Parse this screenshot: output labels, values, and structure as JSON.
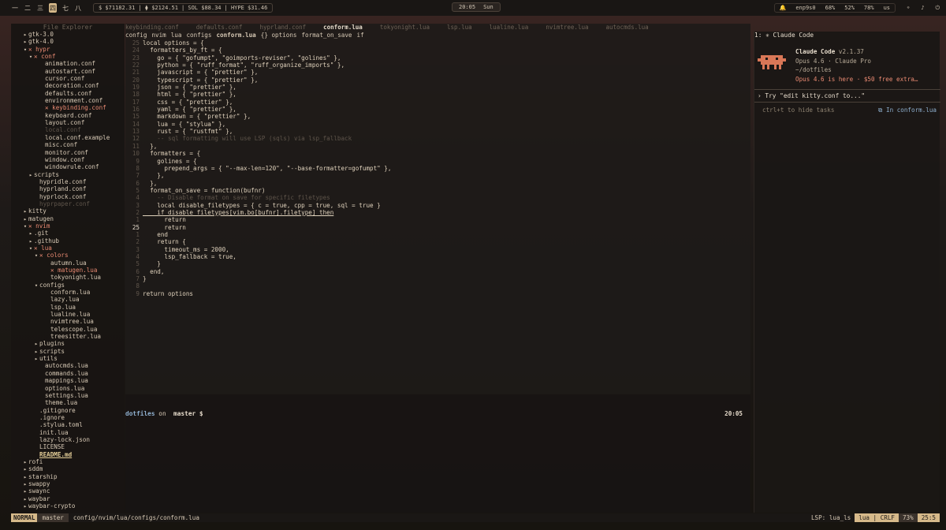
{
  "topbar": {
    "workspaces": [
      "一",
      "二",
      "三",
      "四",
      "七",
      "八"
    ],
    "active_index": 3,
    "crypto": [
      "$ $71182.31",
      "| ⧫ $2124.51",
      "| SOL $88.34",
      "| HYPE $31.46"
    ],
    "clock_time": "20:05",
    "clock_day": "Sun",
    "tray": {
      "network": "enp9s0",
      "cpu": "68%",
      "gpu": "52%",
      "mem": "78%",
      "kb": "us"
    }
  },
  "file_tree": {
    "header": "File Explorer",
    "rows": [
      {
        "indent": 2,
        "icon": "▸",
        "label": "gtk-3.0",
        "cls": ""
      },
      {
        "indent": 2,
        "icon": "▸",
        "label": "gtk-4.0",
        "cls": ""
      },
      {
        "indent": 2,
        "icon": "▾",
        "label": "✕ hypr",
        "cls": "mod"
      },
      {
        "indent": 3,
        "icon": "▾",
        "label": "✕ conf",
        "cls": "mod"
      },
      {
        "indent": 5,
        "icon": "",
        "label": "animation.conf",
        "cls": ""
      },
      {
        "indent": 5,
        "icon": "",
        "label": "autostart.conf",
        "cls": ""
      },
      {
        "indent": 5,
        "icon": "",
        "label": "cursor.conf",
        "cls": ""
      },
      {
        "indent": 5,
        "icon": "",
        "label": "decoration.conf",
        "cls": ""
      },
      {
        "indent": 5,
        "icon": "",
        "label": "defaults.conf",
        "cls": ""
      },
      {
        "indent": 5,
        "icon": "",
        "label": "environment.conf",
        "cls": ""
      },
      {
        "indent": 5,
        "icon": "",
        "label": "✕ keybinding.conf",
        "cls": "mod"
      },
      {
        "indent": 5,
        "icon": "",
        "label": "keyboard.conf",
        "cls": ""
      },
      {
        "indent": 5,
        "icon": "",
        "label": "layout.conf",
        "cls": ""
      },
      {
        "indent": 5,
        "icon": "",
        "label": "local.conf",
        "cls": "dim"
      },
      {
        "indent": 5,
        "icon": "",
        "label": "local.conf.example",
        "cls": ""
      },
      {
        "indent": 5,
        "icon": "",
        "label": "misc.conf",
        "cls": ""
      },
      {
        "indent": 5,
        "icon": "",
        "label": "monitor.conf",
        "cls": ""
      },
      {
        "indent": 5,
        "icon": "",
        "label": "window.conf",
        "cls": ""
      },
      {
        "indent": 5,
        "icon": "",
        "label": "windowrule.conf",
        "cls": ""
      },
      {
        "indent": 3,
        "icon": "▸",
        "label": "scripts",
        "cls": ""
      },
      {
        "indent": 4,
        "icon": "",
        "label": "hypridle.conf",
        "cls": ""
      },
      {
        "indent": 4,
        "icon": "",
        "label": "hyprland.conf",
        "cls": ""
      },
      {
        "indent": 4,
        "icon": "",
        "label": "hyprlock.conf",
        "cls": ""
      },
      {
        "indent": 4,
        "icon": "",
        "label": "hyprpaper.conf",
        "cls": "dim"
      },
      {
        "indent": 2,
        "icon": "▸",
        "label": "kitty",
        "cls": ""
      },
      {
        "indent": 2,
        "icon": "▸",
        "label": "matugen",
        "cls": ""
      },
      {
        "indent": 2,
        "icon": "▾",
        "label": "✕ nvim",
        "cls": "mod"
      },
      {
        "indent": 3,
        "icon": "▸",
        "label": ".git",
        "cls": ""
      },
      {
        "indent": 3,
        "icon": "▸",
        "label": ".github",
        "cls": ""
      },
      {
        "indent": 3,
        "icon": "▾",
        "label": "✕ lua",
        "cls": "mod"
      },
      {
        "indent": 4,
        "icon": "▾",
        "label": "✕ colors",
        "cls": "mod"
      },
      {
        "indent": 6,
        "icon": "",
        "label": "autumn.lua",
        "cls": ""
      },
      {
        "indent": 6,
        "icon": "",
        "label": "✕ matugen.lua",
        "cls": "mod"
      },
      {
        "indent": 6,
        "icon": "",
        "label": "tokyonight.lua",
        "cls": ""
      },
      {
        "indent": 4,
        "icon": "▾",
        "label": "configs",
        "cls": ""
      },
      {
        "indent": 6,
        "icon": "",
        "label": "conform.lua",
        "cls": ""
      },
      {
        "indent": 6,
        "icon": "",
        "label": "lazy.lua",
        "cls": ""
      },
      {
        "indent": 6,
        "icon": "",
        "label": "lsp.lua",
        "cls": ""
      },
      {
        "indent": 6,
        "icon": "",
        "label": "lualine.lua",
        "cls": ""
      },
      {
        "indent": 6,
        "icon": "",
        "label": "nvimtree.lua",
        "cls": ""
      },
      {
        "indent": 6,
        "icon": "",
        "label": "telescope.lua",
        "cls": ""
      },
      {
        "indent": 6,
        "icon": "",
        "label": "treesitter.lua",
        "cls": ""
      },
      {
        "indent": 4,
        "icon": "▸",
        "label": "plugins",
        "cls": ""
      },
      {
        "indent": 4,
        "icon": "▸",
        "label": "scripts",
        "cls": ""
      },
      {
        "indent": 4,
        "icon": "▸",
        "label": "utils",
        "cls": ""
      },
      {
        "indent": 5,
        "icon": "",
        "label": "autocmds.lua",
        "cls": ""
      },
      {
        "indent": 5,
        "icon": "",
        "label": "commands.lua",
        "cls": ""
      },
      {
        "indent": 5,
        "icon": "",
        "label": "mappings.lua",
        "cls": ""
      },
      {
        "indent": 5,
        "icon": "",
        "label": "options.lua",
        "cls": ""
      },
      {
        "indent": 5,
        "icon": "",
        "label": "settings.lua",
        "cls": ""
      },
      {
        "indent": 5,
        "icon": "",
        "label": "theme.lua",
        "cls": ""
      },
      {
        "indent": 4,
        "icon": "",
        "label": ".gitignore",
        "cls": ""
      },
      {
        "indent": 4,
        "icon": "",
        "label": ".ignore",
        "cls": ""
      },
      {
        "indent": 4,
        "icon": "",
        "label": ".stylua.toml",
        "cls": ""
      },
      {
        "indent": 4,
        "icon": "",
        "label": "init.lua",
        "cls": ""
      },
      {
        "indent": 4,
        "icon": "",
        "label": "lazy-lock.json",
        "cls": ""
      },
      {
        "indent": 4,
        "icon": "",
        "label": "LICENSE",
        "cls": ""
      },
      {
        "indent": 4,
        "icon": "",
        "label": "README.md",
        "cls": "readme"
      },
      {
        "indent": 2,
        "icon": "▸",
        "label": "rofi",
        "cls": ""
      },
      {
        "indent": 2,
        "icon": "▸",
        "label": "sddm",
        "cls": ""
      },
      {
        "indent": 2,
        "icon": "▸",
        "label": "starship",
        "cls": ""
      },
      {
        "indent": 2,
        "icon": "▸",
        "label": "swappy",
        "cls": ""
      },
      {
        "indent": 2,
        "icon": "▸",
        "label": "swaync",
        "cls": ""
      },
      {
        "indent": 2,
        "icon": "▸",
        "label": "waybar",
        "cls": ""
      },
      {
        "indent": 2,
        "icon": "▸",
        "label": "waybar-crypto",
        "cls": ""
      }
    ]
  },
  "editor": {
    "tabs": [
      {
        "label": "keybinding.conf",
        "active": false
      },
      {
        "label": "defaults.conf",
        "active": false
      },
      {
        "label": "hyprland.conf",
        "active": false
      },
      {
        "label": "conform.lua",
        "active": true
      },
      {
        "label": "tokyonight.lua",
        "active": false
      },
      {
        "label": "lsp.lua",
        "active": false
      },
      {
        "label": "lualine.lua",
        "active": false
      },
      {
        "label": "nvimtree.lua",
        "active": false
      },
      {
        "label": "autocmds.lua",
        "active": false
      }
    ],
    "breadcrumb": [
      "config",
      "nvim",
      "lua",
      "configs",
      "conform.lua",
      "{} options",
      "format_on_save",
      "if"
    ],
    "lines": [
      {
        "n": "25",
        "t": "local options = {",
        "c": ""
      },
      {
        "n": "24",
        "t": "  formatters_by_ft = {",
        "c": ""
      },
      {
        "n": "23",
        "t": "    go = { \"gofumpt\", \"goimports-reviser\", \"golines\" },",
        "c": ""
      },
      {
        "n": "22",
        "t": "    python = { \"ruff_format\", \"ruff_organize_imports\" },",
        "c": ""
      },
      {
        "n": "21",
        "t": "    javascript = { \"prettier\" },",
        "c": ""
      },
      {
        "n": "20",
        "t": "    typescript = { \"prettier\" },",
        "c": ""
      },
      {
        "n": "19",
        "t": "    json = { \"prettier\" },",
        "c": ""
      },
      {
        "n": "18",
        "t": "    html = { \"prettier\" },",
        "c": ""
      },
      {
        "n": "17",
        "t": "    css = { \"prettier\" },",
        "c": ""
      },
      {
        "n": "16",
        "t": "    yaml = { \"prettier\" },",
        "c": ""
      },
      {
        "n": "15",
        "t": "    markdown = { \"prettier\" },",
        "c": ""
      },
      {
        "n": "14",
        "t": "    lua = { \"stylua\" },",
        "c": ""
      },
      {
        "n": "13",
        "t": "    rust = { \"rustfmt\" },",
        "c": ""
      },
      {
        "n": "12",
        "t": "    -- sql formatting will use LSP (sqls) via lsp_fallback",
        "c": "cmt"
      },
      {
        "n": "11",
        "t": "  },",
        "c": ""
      },
      {
        "n": "10",
        "t": "  formatters = {",
        "c": ""
      },
      {
        "n": "9",
        "t": "    golines = {",
        "c": ""
      },
      {
        "n": "8",
        "t": "      prepend_args = { \"--max-len=120\", \"--base-formatter=gofumpt\" },",
        "c": ""
      },
      {
        "n": "7",
        "t": "    },",
        "c": ""
      },
      {
        "n": "6",
        "t": "  },",
        "c": ""
      },
      {
        "n": "5",
        "t": "  format_on_save = function(bufnr)",
        "c": ""
      },
      {
        "n": "4",
        "t": "    -- Disable format on save for specific filetypes",
        "c": "cmt"
      },
      {
        "n": "3",
        "t": "    local disable_filetypes = { c = true, cpp = true, sql = true }",
        "c": ""
      },
      {
        "n": "2",
        "t": "    if disable_filetypes[vim.bo[bufnr].filetype] then",
        "c": "cur"
      },
      {
        "n": "1",
        "t": "      return",
        "c": ""
      },
      {
        "n": "25",
        "t": "      return",
        "c": "curline"
      },
      {
        "n": "1",
        "t": "    end",
        "c": ""
      },
      {
        "n": "2",
        "t": "    return {",
        "c": ""
      },
      {
        "n": "3",
        "t": "      timeout_ms = 2000,",
        "c": ""
      },
      {
        "n": "4",
        "t": "      lsp_fallback = true,",
        "c": ""
      },
      {
        "n": "5",
        "t": "    }",
        "c": ""
      },
      {
        "n": "6",
        "t": "  end,",
        "c": ""
      },
      {
        "n": "7",
        "t": "}",
        "c": ""
      },
      {
        "n": "8",
        "t": "",
        "c": ""
      },
      {
        "n": "9",
        "t": "return options",
        "c": ""
      }
    ]
  },
  "terminal": {
    "dir": "dotfiles",
    "on": " on ",
    "branch": " master $",
    "time": "20:05"
  },
  "claude": {
    "title": "1: ✳ Claude Code",
    "name": "Claude Code",
    "version": "v2.1.37",
    "model": "Opus 4.6 · Claude Pro",
    "cwd": "~/dotfiles",
    "promo": "Opus 4.6 is here · $50 free extra…",
    "input": "› Try \"edit kitty.conf to...\"",
    "hint": "ctrl+t to hide tasks",
    "context": "⧉ In conform.lua"
  },
  "statusline": {
    "mode": "NORMAL",
    "branch": " master",
    "path": "config/nvim/lua/configs/conform.lua",
    "lsp": "LSP: lua_ls",
    "filetype": " lua | CRLF",
    "percent": "73%",
    "pos": "25:5"
  }
}
